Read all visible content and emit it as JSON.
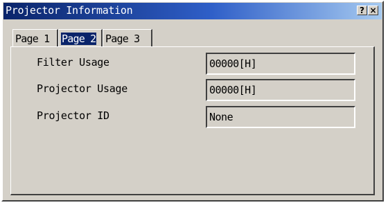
{
  "window": {
    "title": "Projector Information",
    "help_button": "?",
    "close_button": "×"
  },
  "tabs": [
    {
      "label": "Page 1",
      "selected": false
    },
    {
      "label": "Page 2",
      "selected": true
    },
    {
      "label": "Page 3",
      "selected": false
    }
  ],
  "fields": [
    {
      "label": "Filter Usage",
      "value": "00000[H]"
    },
    {
      "label": "Projector Usage",
      "value": "00000[H]"
    },
    {
      "label": "Projector ID",
      "value": "None"
    }
  ],
  "colors": {
    "titlebar_start": "#0a246a",
    "titlebar_end": "#a6caf0",
    "face": "#d4d0c8",
    "selection": "#0a246a"
  }
}
